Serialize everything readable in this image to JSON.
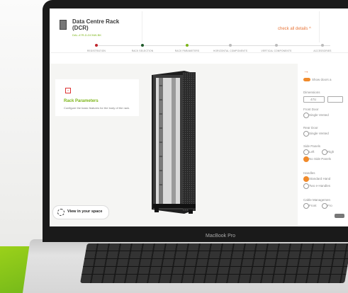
{
  "device": {
    "model_label": "MacBook Pro"
  },
  "app": {
    "title_line1": "Data Centre Rack",
    "title_line2": "(DCR)",
    "product_code": "DAL-47R-D-DCNW-BK",
    "check_details": "check all details ^",
    "steps": [
      {
        "label": "REGISTRATION",
        "status": "done"
      },
      {
        "label": "RACK SELECTION",
        "status": "done"
      },
      {
        "label": "RACK PARAMETERS",
        "status": "active"
      },
      {
        "label": "HORIZONTAL COMPONENTS",
        "status": "pending"
      },
      {
        "label": "VERTICAL COMPONENTS",
        "status": "pending"
      },
      {
        "label": "ACCESSORIES",
        "status": "pending"
      }
    ],
    "card": {
      "heading": "Rack Parameters",
      "text": "Configure the basic features for the body of the rack."
    },
    "view_button": "View in your space",
    "panel": {
      "arrow": "→",
      "show_doors": "Show doors a",
      "dimensions_label": "Dimensions",
      "dimension_value": "47U",
      "front_door_label": "Front Door",
      "front_door_option": "Single Vented",
      "rear_door_label": "Rear Door",
      "rear_door_option": "Single Vented",
      "side_panels_label": "Side Panels",
      "side_left": "Left",
      "side_right": "Righ",
      "side_none": "No Side Panels",
      "handles_label": "Handles",
      "handle_standard": "Standard Hand",
      "handle_two": "Two e-Handles",
      "cable_label": "Cable Managemen",
      "cable_front": "Front",
      "cable_fro": "Fro"
    }
  },
  "colors": {
    "accent": "#7cb518",
    "orange": "#f08a2b",
    "red": "#c0262d"
  }
}
